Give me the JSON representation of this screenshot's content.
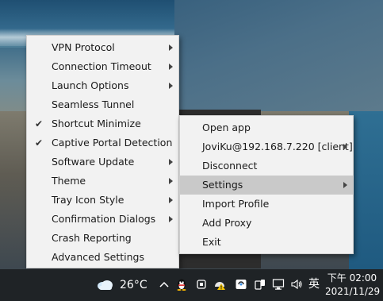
{
  "left_menu": {
    "items": [
      {
        "label": "VPN Protocol",
        "checked": false,
        "submenu": true
      },
      {
        "label": "Connection Timeout",
        "checked": false,
        "submenu": true
      },
      {
        "label": "Launch Options",
        "checked": false,
        "submenu": true
      },
      {
        "label": "Seamless Tunnel",
        "checked": false,
        "submenu": false
      },
      {
        "label": "Shortcut Minimize",
        "checked": true,
        "submenu": false
      },
      {
        "label": "Captive Portal Detection",
        "checked": true,
        "submenu": false
      },
      {
        "label": "Software Update",
        "checked": false,
        "submenu": true
      },
      {
        "label": "Theme",
        "checked": false,
        "submenu": true
      },
      {
        "label": "Tray Icon Style",
        "checked": false,
        "submenu": true
      },
      {
        "label": "Confirmation Dialogs",
        "checked": false,
        "submenu": true
      },
      {
        "label": "Crash Reporting",
        "checked": false,
        "submenu": false
      },
      {
        "label": "Advanced Settings",
        "checked": false,
        "submenu": false
      }
    ]
  },
  "right_menu": {
    "items": [
      {
        "label": "Open app",
        "submenu": false,
        "highlighted": false
      },
      {
        "label": "JoviKu@192.168.7.220 [client]",
        "submenu": true,
        "highlighted": false
      },
      {
        "label": "Disconnect",
        "submenu": false,
        "highlighted": false
      },
      {
        "label": "Settings",
        "submenu": true,
        "highlighted": true
      },
      {
        "label": "Import Profile",
        "submenu": false,
        "highlighted": false
      },
      {
        "label": "Add Proxy",
        "submenu": false,
        "highlighted": false
      },
      {
        "label": "Exit",
        "submenu": false,
        "highlighted": false
      }
    ]
  },
  "check_glyph": "✔",
  "taskbar": {
    "temperature": "26°C",
    "ime_indicator": "英",
    "time": "下午 02:00",
    "date": "2021/11/29",
    "icons": [
      "weather-cloud-icon",
      "show-hidden-icons-chevron-icon",
      "qq-penguin-icon",
      "vpn-client-icon",
      "camera-icon",
      "network-warning-icon",
      "security-icon",
      "phone-link-icon",
      "network-icon",
      "volume-icon"
    ]
  },
  "colors": {
    "menu_bg": "#f2f2f2",
    "menu_highlight": "#c9c9c9",
    "taskbar_bg": "#1f2326"
  }
}
